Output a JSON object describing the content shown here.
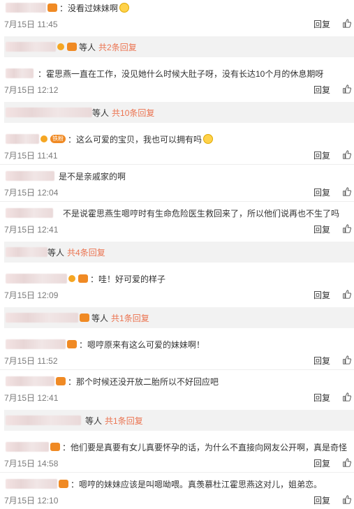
{
  "reply_label": "回复",
  "comments": [
    {
      "text": "：没看过妹妹啊",
      "time": "7月15日 11:45"
    },
    {
      "sub": "等人",
      "count": "共2条回复"
    },
    {
      "text": "：霍思燕一直在工作，没见她什么时候大肚子呀，没有长达10个月的休息期呀",
      "time": "7月15日 12:12"
    },
    {
      "sub": "等人",
      "count": "共10条回复"
    },
    {
      "text": "：这么可爱的宝贝，我也可以拥有吗",
      "time": "7月15日 11:41"
    },
    {
      "text": "是不是亲戚家的啊",
      "time": "7月15日 12:04"
    },
    {
      "text": "不是说霍思燕生嗯哼时有生命危险医生救回来了，所以他们说再也不生了吗",
      "time": "7月15日 12:41"
    },
    {
      "sub": "等人",
      "count": "共4条回复"
    },
    {
      "text": "：哇！好可爱的样子",
      "time": "7月15日 12:09"
    },
    {
      "sub": "等人",
      "count": "共1条回复"
    },
    {
      "text": "：嗯哼原来有这么可爱的妹妹啊！",
      "time": "7月15日 11:52"
    },
    {
      "text": "：那个时候还没开放二胎所以不好回应吧",
      "time": "7月15日 12:41"
    },
    {
      "sub": "等人",
      "count": "共1条回复"
    },
    {
      "text": "：他们要是真要有女儿真要怀孕的话，为什么不直接向网友公开啊，真是奇怪",
      "time": "7月15日 14:58"
    },
    {
      "text": "：嗯哼的妹妹应该是叫嗯呦喂。真羡慕杜江霍思燕这对儿，姐弟恋。",
      "time": "7月15日 12:10"
    }
  ],
  "badges": {
    "fan": "铁粉"
  },
  "icons": {
    "like": "thumbs-up-icon",
    "vip": "vip-crown-icon",
    "emoji": "emoji-icon"
  },
  "colors": {
    "count": "#eb7350",
    "sub_bg": "#f2f2f2",
    "meta": "#7a7a7a"
  }
}
